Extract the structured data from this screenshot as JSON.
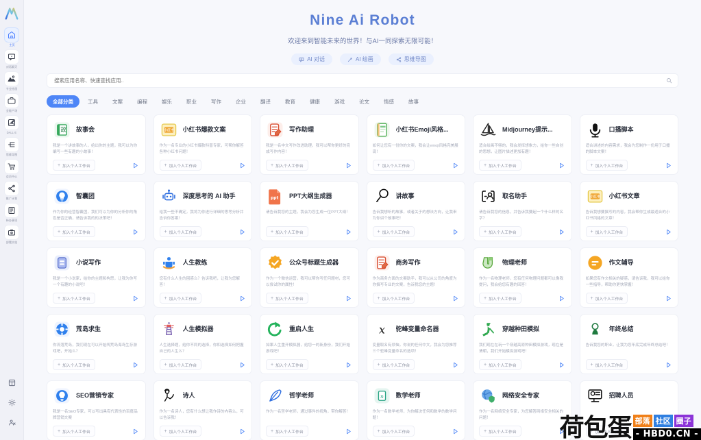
{
  "sidebar": {
    "logo_name": "nine-ai-logo",
    "items": [
      {
        "label": "主页",
        "icon": "home-icon",
        "active": true
      },
      {
        "label": "对话聊天",
        "icon": "chat-icon",
        "active": false
      },
      {
        "label": "专业绘画",
        "icon": "image-icon",
        "active": false
      },
      {
        "label": "全能产场",
        "icon": "briefcase-icon",
        "active": false
      },
      {
        "label": "DALL·E",
        "icon": "edit-image-icon",
        "active": false
      },
      {
        "label": "思维导图",
        "icon": "mindmap-icon",
        "active": false
      },
      {
        "label": "会员中心",
        "icon": "cart-icon",
        "active": false
      },
      {
        "label": "推广计划",
        "icon": "share-icon",
        "active": false
      },
      {
        "label": "待办事项",
        "icon": "calendar-icon",
        "active": false
      },
      {
        "label": "部署文档",
        "icon": "toolbox-icon",
        "active": false
      }
    ],
    "bottom_items": [
      {
        "icon": "grid-apps-icon"
      },
      {
        "icon": "sun-theme-icon"
      },
      {
        "icon": "user-account-icon"
      }
    ]
  },
  "hero": {
    "title": "Nine Ai Robot",
    "subtitle": "欢迎来到智能未来的世界！与AI一同探索无限可能！",
    "pills": [
      {
        "label": "AI 对话",
        "icon": "chat-bubble-icon"
      },
      {
        "label": "AI 绘画",
        "icon": "magic-wand-icon"
      },
      {
        "label": "思维导图",
        "icon": "share-nodes-icon"
      }
    ]
  },
  "search": {
    "placeholder": "搜索应用名称、快速查找应用..",
    "value": "",
    "icon": "search-icon"
  },
  "tabs": [
    {
      "label": "全部分类",
      "active": true
    },
    {
      "label": "工具",
      "active": false
    },
    {
      "label": "文案",
      "active": false
    },
    {
      "label": "编程",
      "active": false
    },
    {
      "label": "娱乐",
      "active": false
    },
    {
      "label": "职业",
      "active": false
    },
    {
      "label": "写作",
      "active": false
    },
    {
      "label": "企业",
      "active": false
    },
    {
      "label": "翻译",
      "active": false
    },
    {
      "label": "教育",
      "active": false
    },
    {
      "label": "健康",
      "active": false
    },
    {
      "label": "游戏",
      "active": false
    },
    {
      "label": "论文",
      "active": false
    },
    {
      "label": "情感",
      "active": false
    },
    {
      "label": "故事",
      "active": false
    }
  ],
  "card_actions": {
    "join_label": "加入个人工作台",
    "plus": "+",
    "go_icon": "play-arrow-icon"
  },
  "cards": [
    {
      "title": "故事会",
      "desc": "我是一个讲故事的人，给出你的主题，我可以为你编写一些有趣的小故事！",
      "icon": "book-green-icon"
    },
    {
      "title": "小红书爆款文案",
      "desc": "作为一名专业的小红书爆款科普专家，可帮你解答各种小红书问题！",
      "icon": "xiaohongshu-yellow-icon"
    },
    {
      "title": "写作助理",
      "desc": "我是一名中文写作改进助理，我可以帮你更好的完成写作内容！",
      "icon": "pen-doc-red-icon"
    },
    {
      "title": "小红书Emoji风格...",
      "desc": "如何让您有一份你的文案，我会让emoji风格完美展现！",
      "icon": "notebook-green-icon"
    },
    {
      "title": "Midjourney提示...",
      "desc": "适合绘画不够的，我会发挥想象力，给你一些自创的思想，让图片描述更加有趣！",
      "icon": "sailboat-icon"
    },
    {
      "title": "口播脚本",
      "desc": "适合讲述的内容需求，我会为您制作一份用于口播的脚本文案！",
      "icon": "microphone-icon"
    },
    {
      "title": "智囊团",
      "desc": "作为你的经营智囊团，我们可以为你的分析你的角色是否正确，请告诉我的的决策吧！",
      "icon": "bulb-blue-icon"
    },
    {
      "title": "深度思考的 AI 助手",
      "desc": "给我一些不确定，我将为你进行详细的思考分析并告诉你答案！",
      "icon": "robot-blue-icon"
    },
    {
      "title": "PPT大纲生成器",
      "desc": "请告诉我您的主题，我会为您生成一位PPT大纲！",
      "icon": "ppt-orange-icon"
    },
    {
      "title": "讲故事",
      "desc": "告诉我想听的故事，或者关于的想法方向，让我来为你讲个故事吧！",
      "icon": "magnify-story-icon"
    },
    {
      "title": "取名助手",
      "desc": "请告诉我您的信息，并告诉我要起一个什么样的名字？",
      "icon": "id-card-icon"
    },
    {
      "title": "小红书文章",
      "desc": "告诉我想要撰写的内容，我会帮你生成最适合的小红书风格的文章！",
      "icon": "xiaohongshu-yellow-icon"
    },
    {
      "title": "小说写作",
      "desc": "我是一个小说家，给你的主题和构思，让我为你写一个有趣的小说吧！",
      "icon": "novel-blue-icon"
    },
    {
      "title": "人生教练",
      "desc": "您有什么人生的困惑么？告诉我吧，让我为您解答！",
      "icon": "coach-blue-icon"
    },
    {
      "title": "公众号标题生成器",
      "desc": "作为一个微信运营，我可以帮你写任何题材，您可以尝试你的属性！",
      "icon": "badge-check-orange-icon"
    },
    {
      "title": "商务写作",
      "desc": "作为商务方面的文案助手，我可以从公司的角度为你撰写专业的文案，告诉我您的主题！",
      "icon": "pen-doc-red-icon"
    },
    {
      "title": "物理老师",
      "desc": "作为一名物理老师，您有任何物理问题都可以像我提问，我会给您有趣的回答！",
      "icon": "magnet-green-icon"
    },
    {
      "title": "作文辅导",
      "desc": "如果您有作文相关的疑惑，请告诉我，我可以给你一些指导，帮助你更快掌握！",
      "icon": "equals-orange-icon"
    },
    {
      "title": "荒岛求生",
      "desc": "你流落荒岛，我们现在可以开始闯荒岛海岛生存游戏吧，开始么？",
      "icon": "lifebuoy-blue-icon"
    },
    {
      "title": "人生模拟器",
      "desc": "人生选择题，给你不同的选择，你和选择如何把握自己的人生么？",
      "icon": "lighthouse-icon"
    },
    {
      "title": "重启人生",
      "desc": "如果人生重开模拟器，给您一的新身份，我们开始游戏吧！",
      "icon": "refresh-green-icon"
    },
    {
      "title": "驼峰变量命名器",
      "desc": "变量取名有烦恼，你说的任何中文，我会为您推荐三个驼峰变量命名的选项！",
      "icon": "x-variable-icon"
    },
    {
      "title": "穿越种田模拟",
      "desc": "我们现在在玩一个穿越高原种田模拟游戏，现在是清朝，我们开始模拟游戏吧！",
      "icon": "farmer-green-icon"
    },
    {
      "title": "年终总结",
      "desc": "告诉我您的职业，让我为您年底完成年终总结吧！",
      "icon": "person-green-icon"
    },
    {
      "title": "SEO营销专家",
      "desc": "我是一名SEO专家，可以写出具有代表性的百度品牌营销文案",
      "icon": "bulb-blue-icon"
    },
    {
      "title": "诗人",
      "desc": "作为一名诗人，您有什么想让我作诗的内容么，可以告诉我！",
      "icon": "poet-icon"
    },
    {
      "title": "哲学老师",
      "desc": "作为一名哲学老师，通过事件的视角，带你解答！",
      "icon": "quill-blue-icon"
    },
    {
      "title": "数学老师",
      "desc": "作为一名数学老师，为你解决任何和数学的数学问题！",
      "icon": "math-teal-icon"
    },
    {
      "title": "网络安全专家",
      "desc": "作为一名网络安全专家，为您解答网络安全相关的问题！",
      "icon": "globe-shield-icon"
    },
    {
      "title": "招聘人员",
      "desc": "",
      "icon": "recruiter-icon"
    }
  ],
  "watermark": {
    "text": "荷包蛋",
    "badges": [
      {
        "label": "部落",
        "color": "#f08019"
      },
      {
        "label": "社区",
        "color": "#2f7fe0"
      },
      {
        "label": "圈子",
        "color": "#8c34d8"
      }
    ],
    "url": "- HBD0.CN -"
  }
}
